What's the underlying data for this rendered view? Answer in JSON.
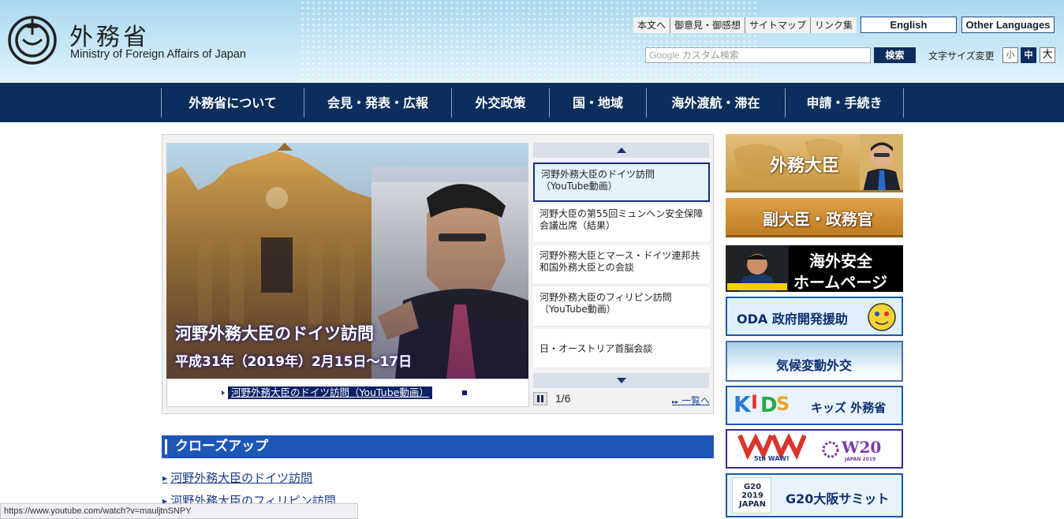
{
  "header": {
    "logo_ja": "外務省",
    "logo_en": "Ministry of Foreign Affairs of Japan",
    "util_links": [
      "本文へ",
      "御意見・御感想",
      "サイトマップ",
      "リンク集"
    ],
    "lang_english": "English",
    "lang_other": "Other Languages",
    "search_brand": "Google",
    "search_placeholder": "カスタム検索",
    "search_button": "検索",
    "font_size_label": "文字サイズ変更",
    "font_sizes": [
      "小",
      "中",
      "大"
    ]
  },
  "nav": {
    "items": [
      "外務省について",
      "会見・発表・広報",
      "外交政策",
      "国・地域",
      "海外渡航・滞在",
      "申請・手続き"
    ]
  },
  "slider": {
    "image_title": "河野外務大臣のドイツ訪問",
    "image_subtitle": "平成31年（2019年）2月15日～17日",
    "caption_link": "河野外務大臣のドイツ訪問（YouTube動画）",
    "list": [
      "河野外務大臣のドイツ訪問（YouTube動画）",
      "河野大臣の第55回ミュンヘン安全保障会議出席（結果）",
      "河野外務大臣とマース・ドイツ連邦共和国外務大臣との会談",
      "河野外務大臣のフィリピン訪問（YouTube動画）",
      "日・オーストリア首脳会談"
    ],
    "counter": "1/6",
    "more_link": "一覧へ",
    "active_index": 0
  },
  "closeup": {
    "heading": "クローズアップ",
    "items": [
      "河野外務大臣のドイツ訪問",
      "河野外務大臣のフィリピン訪問"
    ]
  },
  "status_bar": "https://www.youtube.com/watch?v=mauljtnSNPY",
  "banners": {
    "minister": "外務大臣",
    "vice": "副大臣・政務官",
    "safety_1": "海外安全",
    "safety_2": "ホームページ",
    "oda": "ODA 政府開発援助",
    "climate": "気候変動外交",
    "kids": "キッズ 外務省",
    "waw": "5th WAW!",
    "w20": "W20",
    "w20_sub": "JAPAN 2019",
    "g20": "G20大阪サミット",
    "g20_logo": "G20 2019 JAPAN"
  },
  "colors": {
    "nav_bg": "#0b2e5c",
    "closeup_bg": "#1e56b8",
    "active_item_border": "#162f7a"
  }
}
